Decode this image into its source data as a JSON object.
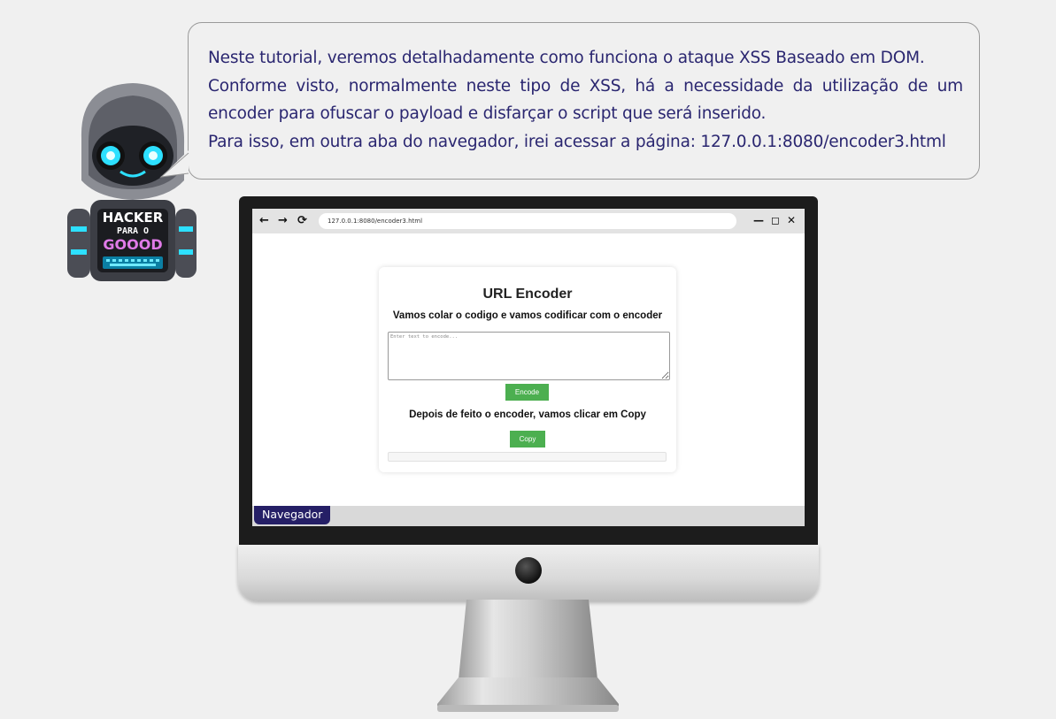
{
  "mascot": {
    "badge_line1": "HACKER",
    "badge_line2": "PARA O",
    "badge_line3": "GOOOD"
  },
  "bubble": {
    "line1": "Neste tutorial, veremos detalhadamente como funciona o ataque XSS Baseado em DOM.",
    "line2": "Conforme visto, normalmente neste tipo de XSS, há a necessidade da utilização de um",
    "line3": "encoder para ofuscar o payload e disfarçar o script que será inserido.",
    "line4": "Para isso, em outra aba do navegador, irei acessar a página: 127.0.0.1:8080/encoder3.html"
  },
  "browser": {
    "back_icon": "←",
    "forward_icon": "→",
    "reload_icon": "⟳",
    "url": "127.0.0.1:8080/encoder3.html",
    "minimize_icon": "—",
    "maximize_icon": "◻",
    "close_icon": "✕"
  },
  "encoder": {
    "title": "URL Encoder",
    "subtitle": "Vamos colar o codigo e vamos codificar com o encoder",
    "input_placeholder": "Enter text to encode...",
    "input_value": "",
    "encode_label": "Encode",
    "subtitle2": "Depois de feito o encoder, vamos clicar em Copy",
    "copy_label": "Copy",
    "output_value": ""
  },
  "taskbar": {
    "tab_label": "Navegador"
  },
  "colors": {
    "text_blue": "#2a2670",
    "button_green": "#4caf50",
    "taskbar_tab": "#251f66"
  }
}
